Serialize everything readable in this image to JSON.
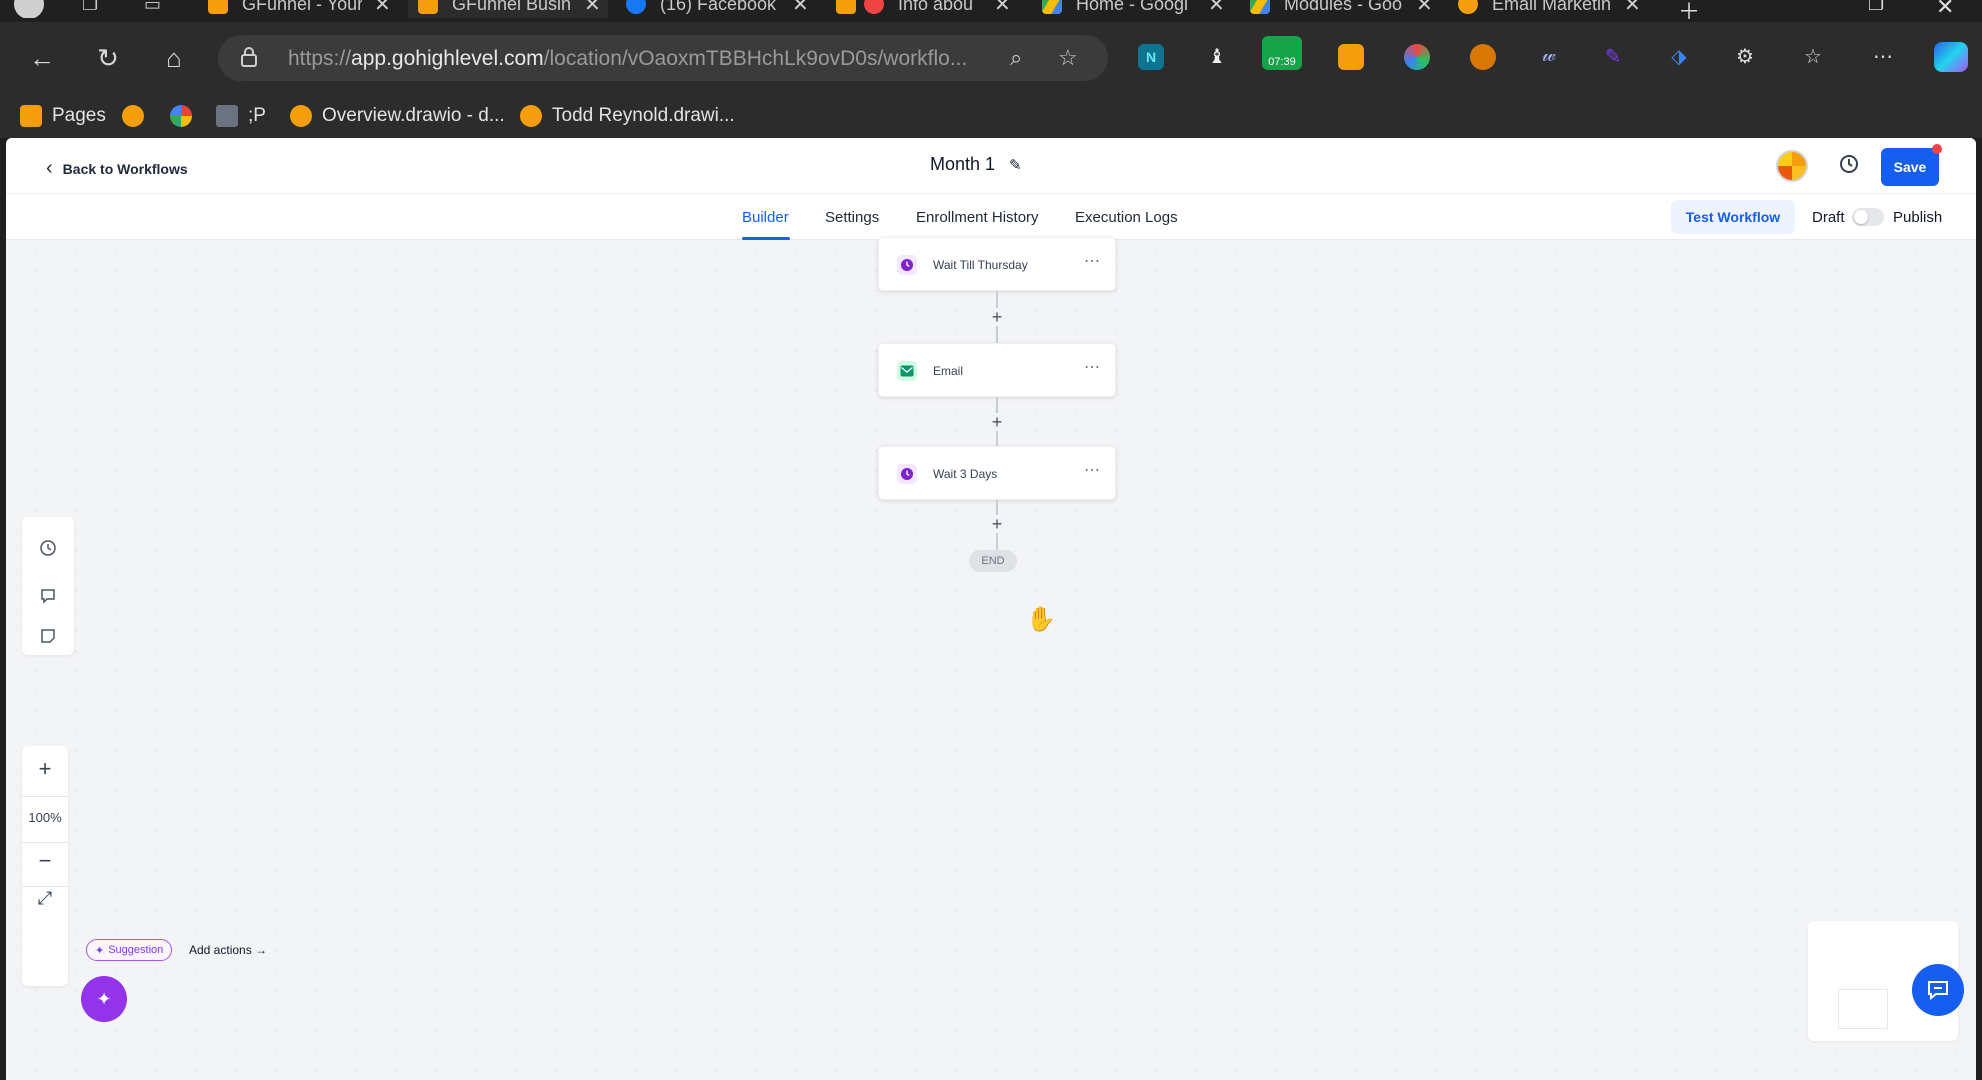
{
  "browser": {
    "tabs": [
      {
        "title": "GFunnel - Your",
        "favicon_color": "#f59e0b",
        "active": false
      },
      {
        "title": "GFunnel Busin",
        "favicon_color": "#f59e0b",
        "active": true
      },
      {
        "title": "(16) Facebook",
        "favicon_color": "#1877f2",
        "active": false
      },
      {
        "title": "Info abou",
        "favicon_color": "#ef4444",
        "active": false
      },
      {
        "title": "Home - Googl",
        "favicon_color": "#34a853",
        "active": false
      },
      {
        "title": "Modules - Goo",
        "favicon_color": "#34a853",
        "active": false
      },
      {
        "title": "Email Marketin",
        "favicon_color": "#f59e0b",
        "active": false
      }
    ],
    "url_prefix": "https://",
    "url_host": "app.gohighlevel.com",
    "url_path": "/location/vOaoxmTBBHchLk9ovD0s/workflo...",
    "extension_badge_time": "07:39",
    "bookmarks": [
      {
        "label": "Pages",
        "color": "#f59e0b"
      },
      {
        "label": "",
        "color": "#f59e0b"
      },
      {
        "label": "",
        "color": "#4285f4"
      },
      {
        "label": ";P",
        "color": "#ea4335"
      },
      {
        "label": "Overview.drawio - d...",
        "color": "#f59e0b"
      },
      {
        "label": "Todd Reynold.drawi...",
        "color": "#f59e0b"
      }
    ]
  },
  "header": {
    "back_label": "Back to Workflows",
    "workflow_name": "Month 1",
    "save_label": "Save"
  },
  "subnav": {
    "tabs": [
      {
        "label": "Builder",
        "active": true
      },
      {
        "label": "Settings",
        "active": false
      },
      {
        "label": "Enrollment History",
        "active": false
      },
      {
        "label": "Execution Logs",
        "active": false
      }
    ],
    "test_workflow_label": "Test Workflow",
    "draft_label": "Draft",
    "publish_label": "Publish",
    "published": false
  },
  "workflow": {
    "nodes": [
      {
        "label": "Wait Till Thursday",
        "icon": "clock-icon",
        "color": "#7e22ce"
      },
      {
        "label": "Email",
        "icon": "email-icon",
        "color": "#059669"
      },
      {
        "label": "Wait 3 Days",
        "icon": "clock-icon",
        "color": "#7e22ce"
      }
    ],
    "end_label": "END"
  },
  "zoom": {
    "level": "100%"
  },
  "suggestion": {
    "badge_label": "Suggestion",
    "action_label": "Add actions"
  },
  "colors": {
    "primary": "#155eef",
    "purple": "#9333ea"
  }
}
